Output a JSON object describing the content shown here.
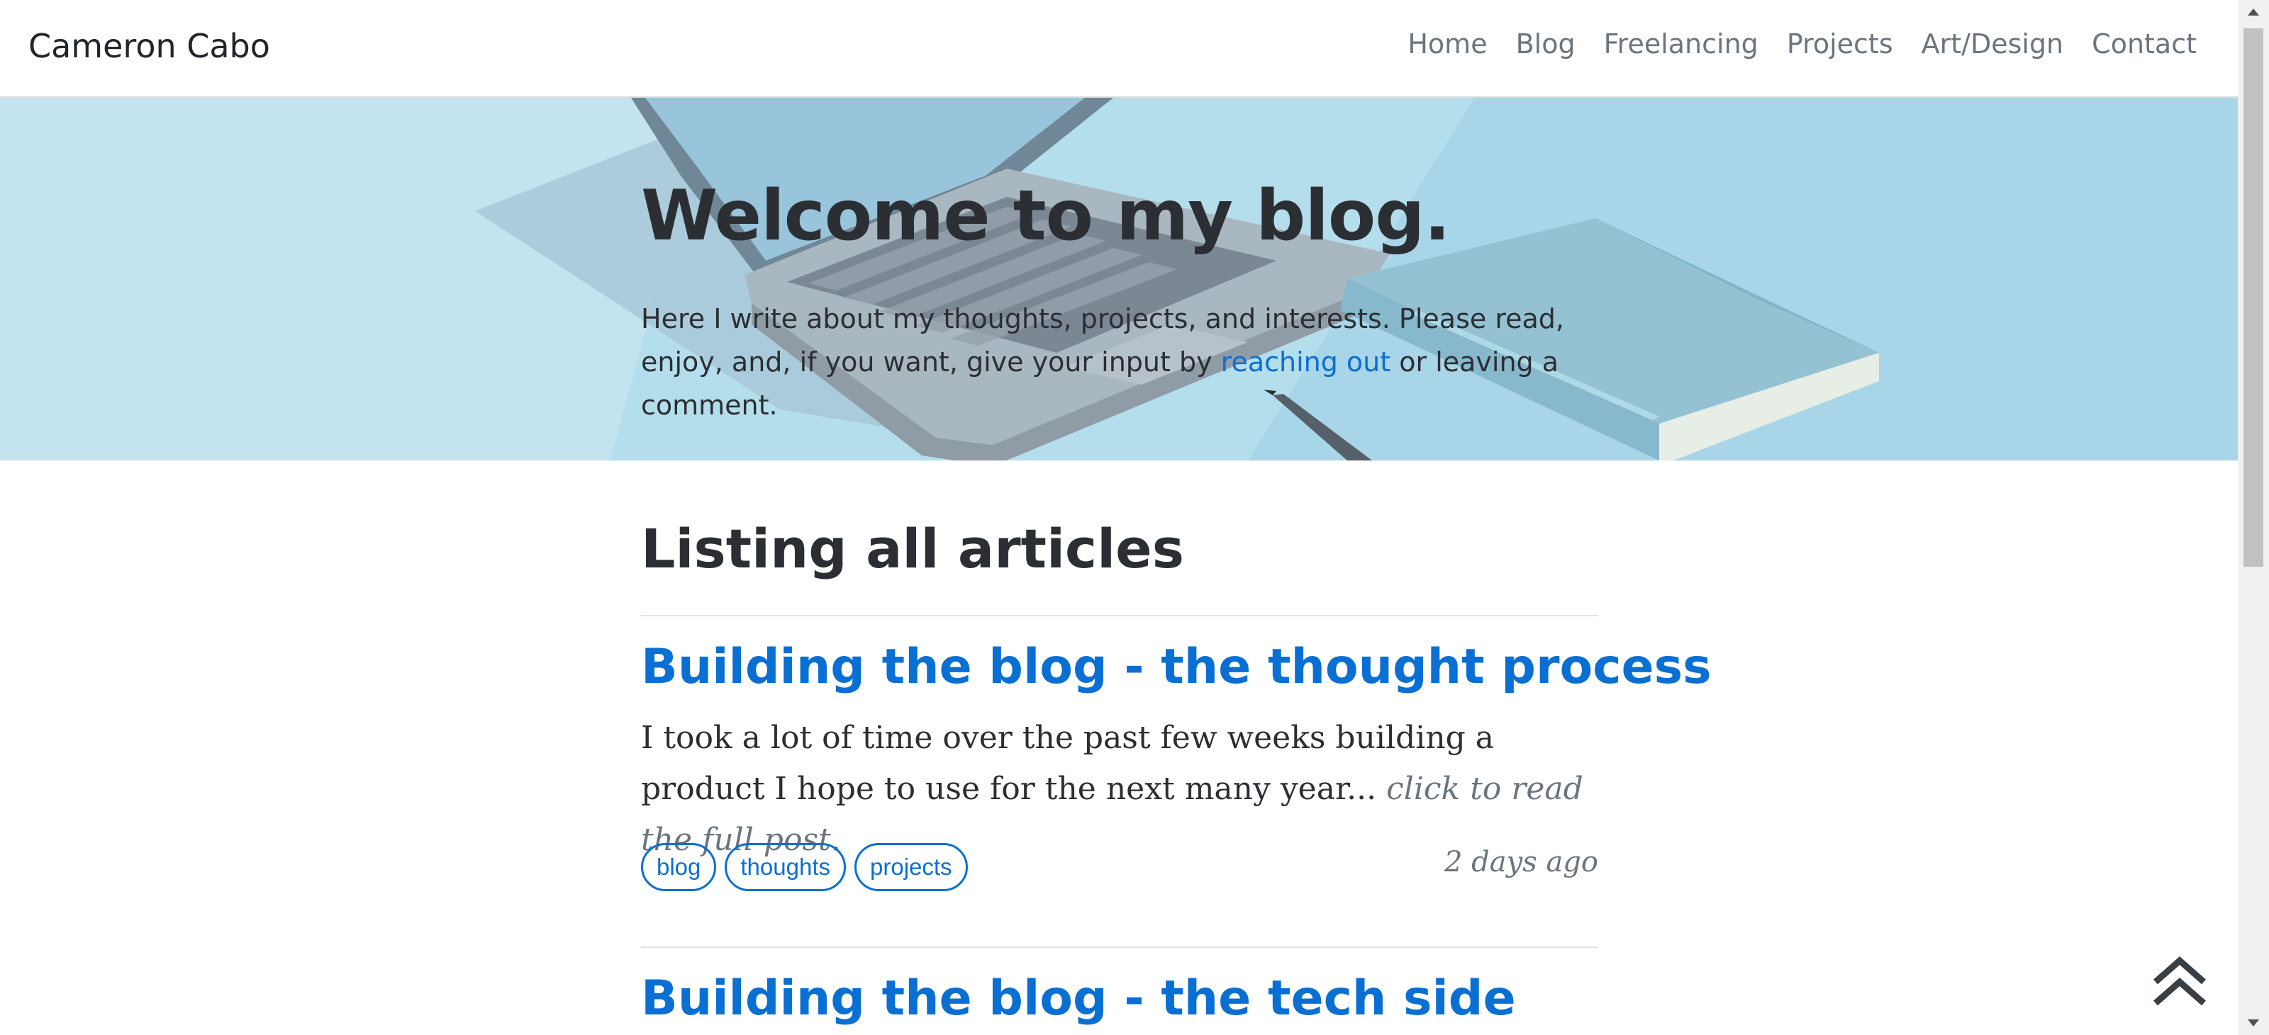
{
  "navbar": {
    "brand": "Cameron Cabo",
    "links": [
      "Home",
      "Blog",
      "Freelancing",
      "Projects",
      "Art/Design",
      "Contact"
    ]
  },
  "hero": {
    "title": "Welcome to my blog.",
    "text_before_link": "Here I write about my thoughts, projects, and interests. Please read, enjoy, and, if you want, give your input by ",
    "link_text": "reaching out",
    "text_after_link": " or leaving a comment."
  },
  "main": {
    "section_title": "Listing all articles",
    "articles": [
      {
        "title": "Building the blog - the thought process",
        "excerpt": "I took a lot of time over the past few weeks building a product I hope to use for the next many year... ",
        "read_more": "click to read the full post.",
        "tags": [
          "blog",
          "thoughts",
          "projects"
        ],
        "date": "2 days ago"
      },
      {
        "title": "Building the blog - the tech side"
      }
    ]
  },
  "icons": {
    "scroll_top": "double-chevron-up-icon"
  },
  "colors": {
    "accent": "#0a6fd3",
    "hero_bg": "#b2ddec",
    "muted": "#6c757d"
  }
}
